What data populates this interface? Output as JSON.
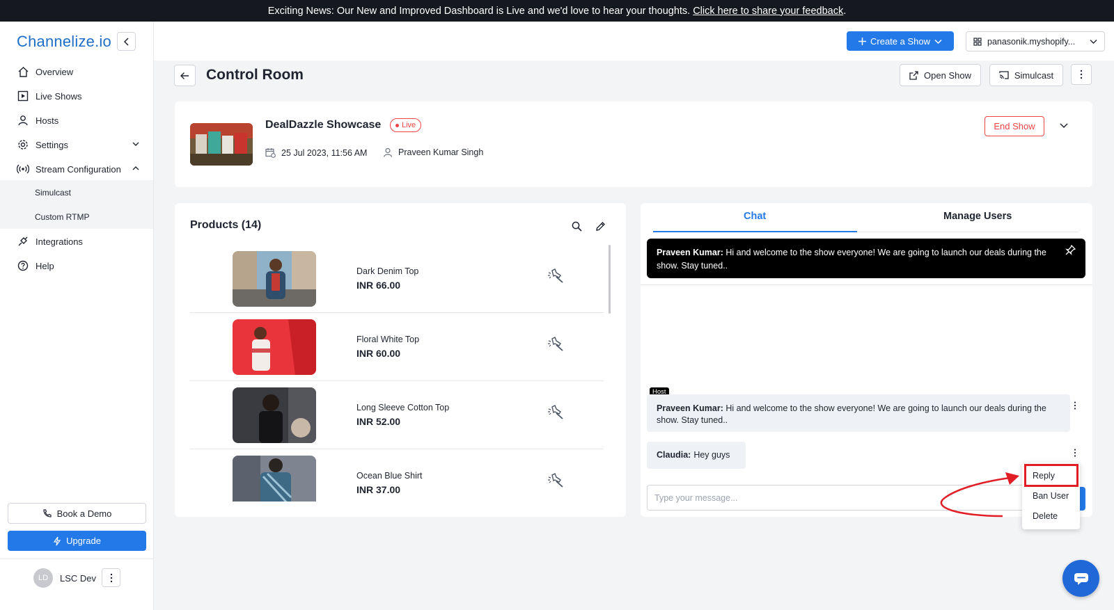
{
  "banner": {
    "text": "Exciting News: Our New and Improved Dashboard is Live and we'd love to hear your thoughts.",
    "link": "Click here to share your feedback",
    "tail": "."
  },
  "brand": {
    "logo": "Channelize.io"
  },
  "sidebar": {
    "items": [
      {
        "label": "Overview",
        "icon": "home-icon"
      },
      {
        "label": "Live Shows",
        "icon": "play-icon"
      },
      {
        "label": "Hosts",
        "icon": "user-icon"
      },
      {
        "label": "Settings",
        "icon": "gear-icon"
      },
      {
        "label": "Stream Configuration",
        "icon": "broadcast-icon"
      },
      {
        "label": "Integrations",
        "icon": "plug-icon"
      },
      {
        "label": "Help",
        "icon": "help-icon"
      }
    ],
    "sub_items": [
      "Simulcast",
      "Custom RTMP"
    ],
    "book_demo": "Book a Demo",
    "upgrade": "Upgrade",
    "user": {
      "initials": "LD",
      "name": "LSC Dev"
    }
  },
  "topbar": {
    "create_show": "Create a Show",
    "store": "panasonik.myshopify..."
  },
  "page": {
    "title": "Control Room",
    "open_show": "Open Show",
    "simulcast": "Simulcast"
  },
  "show": {
    "name": "DealDazzle Showcase",
    "status": "Live",
    "date": "25 Jul 2023, 11:56 AM",
    "host": "Praveen Kumar Singh",
    "end_show": "End Show"
  },
  "products": {
    "title": "Products (14)",
    "items": [
      {
        "name": "Dark Denim Top",
        "price": "INR 66.00"
      },
      {
        "name": "Floral White Top",
        "price": "INR 60.00"
      },
      {
        "name": "Long Sleeve Cotton Top",
        "price": "INR 52.00"
      },
      {
        "name": "Ocean Blue Shirt",
        "price": "INR 37.00"
      }
    ]
  },
  "chat": {
    "tabs": [
      "Chat",
      "Manage Users"
    ],
    "pinned": {
      "author": "Praveen Kumar:",
      "text": "Hi and welcome to the show everyone! We are going to launch our deals during the show. Stay tuned.."
    },
    "messages": [
      {
        "badge": "Host",
        "author": "Praveen Kumar:",
        "text": "Hi and welcome to the show everyone! We are going to launch our deals during the show. Stay tuned.."
      },
      {
        "author": "Claudia:",
        "text": "Hey guys"
      }
    ],
    "input_placeholder": "Type your message...",
    "context_menu": [
      "Reply",
      "Ban User",
      "Delete"
    ]
  },
  "colors": {
    "accent": "#2379e8",
    "live": "#ef4444",
    "annotation": "#e11d26",
    "banner_bg": "#16181f"
  }
}
